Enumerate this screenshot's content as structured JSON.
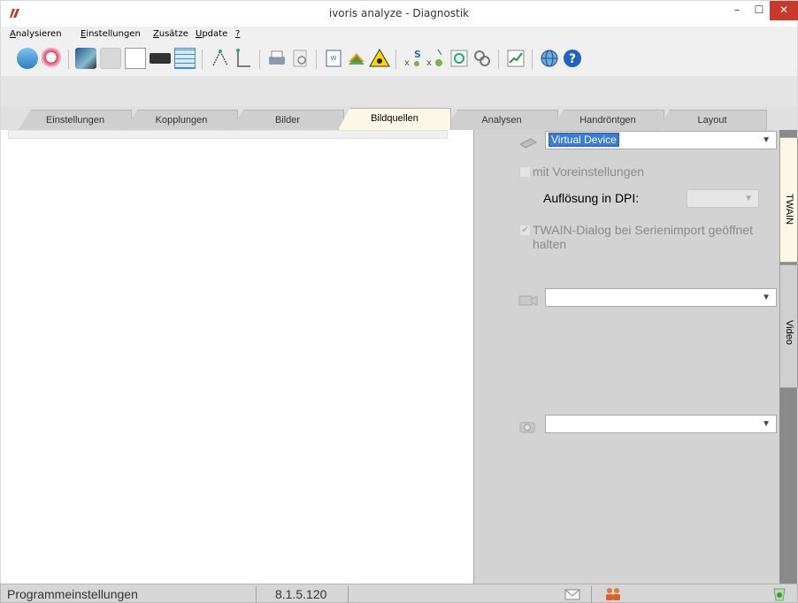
{
  "window": {
    "title": "ivoris analyze - Diagnostik",
    "minimize_glyph": "–",
    "maximize_glyph": "☐",
    "close_glyph": "✕"
  },
  "menu": [
    {
      "underline": "A",
      "rest": "nalysieren"
    },
    {
      "underline": "E",
      "rest": "instellungen"
    },
    {
      "underline": "Z",
      "rest": "usätze"
    },
    {
      "underline": "U",
      "rest": "pdate"
    },
    {
      "underline": "?",
      "rest": ""
    }
  ],
  "toolbar_icons": [
    "database-icon",
    "search-image-icon",
    "image-adjust-icon",
    "3d-icon",
    "blank-icon",
    "intraoral-camera-icon",
    "table-icon",
    "measure-angle-icon",
    "measure-line-icon",
    "print-icon",
    "print-preview-icon",
    "word-export-icon",
    "layers-icon",
    "radiation-warning-icon",
    "symbol-s-icon",
    "symbol-x-icon",
    "gear-image-icon",
    "link-icon",
    "chart-icon",
    "globe-icon",
    "help-icon"
  ],
  "tabs": [
    "Einstellungen",
    "Kopplungen",
    "Bilder",
    "Bildquellen",
    "Analysen",
    "Handröntgen",
    "Layout"
  ],
  "active_tab": "Bildquellen",
  "twain": {
    "device_value": "Virtual Device",
    "presets_label": "mit Voreinstellungen",
    "dpi_label": "Auflösung in DPI:",
    "dpi_value": "",
    "dialog_label": "TWAIN-Dialog bei Serienimport geöffnet halten",
    "dialog_checked": true
  },
  "video": {
    "device_value": ""
  },
  "camera": {
    "device_value": ""
  },
  "side_tabs": [
    "TWAIN",
    "Video"
  ],
  "status": {
    "left": "Programmeinstellungen",
    "version": "8.1.5.120"
  },
  "colors": {
    "active_tab": "#fdf8e6",
    "selection": "#3a7bd5",
    "close_button": "#c8392b"
  }
}
